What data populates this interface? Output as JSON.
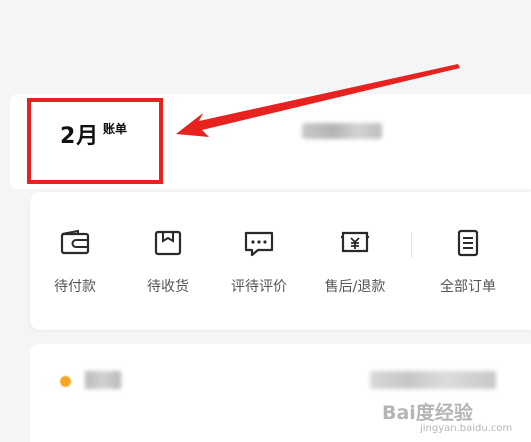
{
  "bill": {
    "month": "2月",
    "label": "账单"
  },
  "orders": {
    "items": [
      {
        "label": "待付款",
        "icon": "wallet-icon"
      },
      {
        "label": "待收货",
        "icon": "package-icon"
      },
      {
        "label": "评待评价",
        "icon": "comment-icon"
      },
      {
        "label": "售后/退款",
        "icon": "refund-icon"
      },
      {
        "label": "全部订单",
        "icon": "order-list-icon"
      }
    ]
  },
  "watermark": {
    "text": "Bai度经验",
    "sub": "jingyan.baidu.com"
  },
  "colors": {
    "annotation_red": "#e8221f",
    "background": "#f4f5f7",
    "card": "#ffffff",
    "accent_dot": "#f6a623"
  }
}
